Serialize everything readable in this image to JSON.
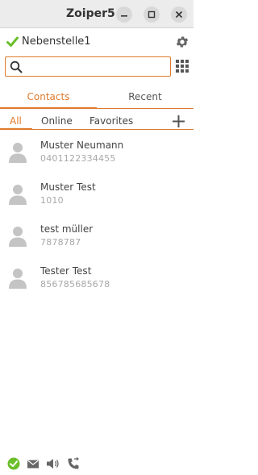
{
  "window": {
    "title": "Zoiper5",
    "buttons": [
      "minimize-icon",
      "maximize-icon",
      "close-icon"
    ]
  },
  "account": {
    "name": "Nebenstelle1",
    "status_icon": "check-icon",
    "settings_icon": "gear-icon"
  },
  "search": {
    "value": "",
    "placeholder": "",
    "icon": "search-icon"
  },
  "main_tabs": [
    {
      "label": "Contacts",
      "active": true
    },
    {
      "label": "Recent",
      "active": false
    }
  ],
  "sub_tabs": [
    {
      "label": "All",
      "active": true
    },
    {
      "label": "Online",
      "active": false
    },
    {
      "label": "Favorites",
      "active": false
    }
  ],
  "contacts": [
    {
      "name": "Muster Neumann",
      "number": "0401122334455"
    },
    {
      "name": "Muster Test",
      "number": "1010"
    },
    {
      "name": "test müller",
      "number": "7878787"
    },
    {
      "name": "Tester Test",
      "number": "856785685678"
    }
  ],
  "footer_icons": [
    "status-check-icon",
    "mail-icon",
    "speaker-icon",
    "phone-forward-icon"
  ],
  "colors": {
    "accent": "#e07a2c",
    "status_green": "#6abf2a",
    "icon_gray": "#c4c4c4",
    "number_gray": "#a8a8a8"
  }
}
